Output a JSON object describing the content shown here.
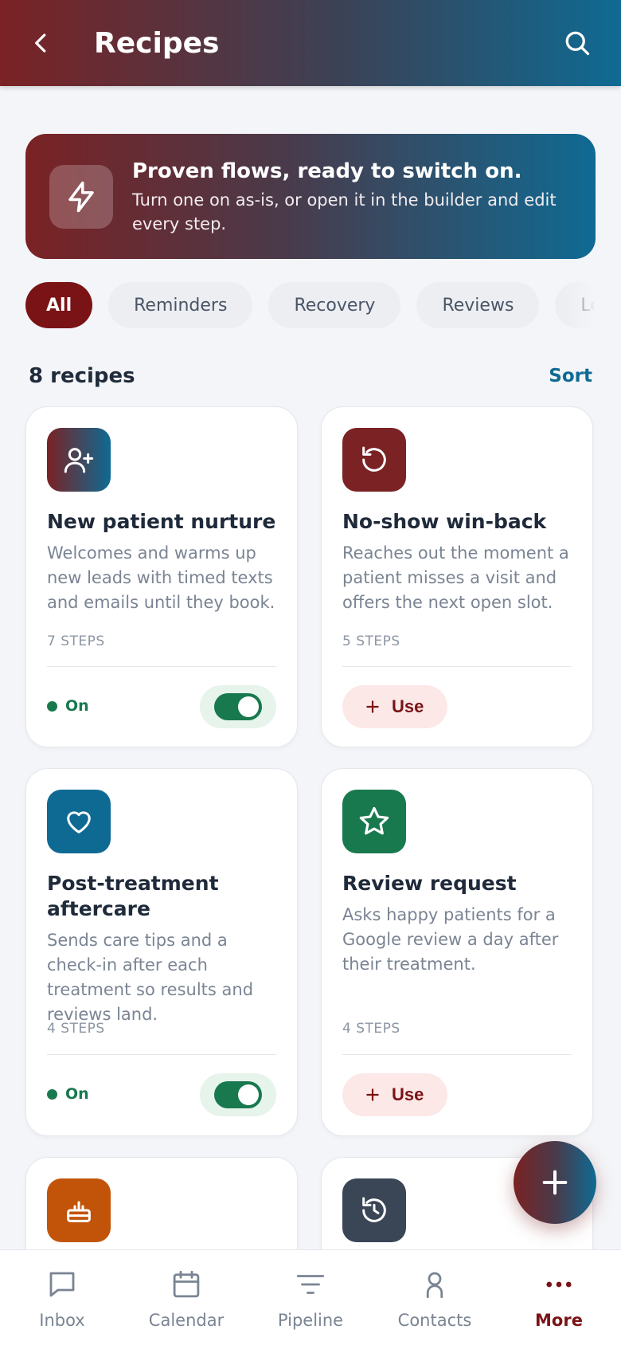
{
  "header": {
    "title": "Recipes",
    "back_icon": "chevron-left-icon",
    "search_icon": "search-icon"
  },
  "hero": {
    "icon": "bolt-icon",
    "heading": "Proven flows, ready to switch on.",
    "body": "Turn one on as-is, or open it in the builder and edit every step."
  },
  "filters": [
    {
      "label": "All",
      "active": true
    },
    {
      "label": "Reminders",
      "active": false
    },
    {
      "label": "Recovery",
      "active": false
    },
    {
      "label": "Reviews",
      "active": false
    },
    {
      "label": "Lead f",
      "active": false
    }
  ],
  "list": {
    "count_label": "8 recipes",
    "sort_label": "Sort"
  },
  "recipes": [
    {
      "name": "New patient nurture",
      "description": "Welcomes and warms up new leads with timed texts and emails until they book.",
      "steps": "7 STEPS",
      "state": "on",
      "status_label": "On",
      "icon": "user-plus-icon",
      "icon_color": "gradient"
    },
    {
      "name": "No-show win-back",
      "description": "Reaches out the moment a patient misses a visit and offers the next open slot.",
      "steps": "5 STEPS",
      "state": "off",
      "use_label": "Use",
      "icon": "rotate-ccw-icon",
      "icon_color": "#7a2224"
    },
    {
      "name": "Post-treatment aftercare",
      "description": "Sends care tips and a check-in after each treatment so results and reviews land.",
      "steps": "4 STEPS",
      "state": "on",
      "status_label": "On",
      "icon": "heart-icon",
      "icon_color": "#0f6a93"
    },
    {
      "name": "Review request",
      "description": "Asks happy patients for a Google review a day after their treatment.",
      "steps": "4 STEPS",
      "state": "off",
      "use_label": "Use",
      "icon": "star-icon",
      "icon_color": "#18794e"
    },
    {
      "name": "",
      "description": "",
      "steps": "",
      "state": "",
      "icon": "cake-icon",
      "icon_color": "#c2540a"
    },
    {
      "name": "",
      "description": "",
      "steps": "",
      "state": "",
      "icon": "history-icon",
      "icon_color": "#3a4656"
    }
  ],
  "fab": {
    "icon": "plus-icon"
  },
  "bottom_nav": [
    {
      "label": "Inbox",
      "icon": "message-icon",
      "active": false
    },
    {
      "label": "Calendar",
      "icon": "calendar-icon",
      "active": false
    },
    {
      "label": "Pipeline",
      "icon": "filter-icon",
      "active": false
    },
    {
      "label": "Contacts",
      "icon": "person-icon",
      "active": false
    },
    {
      "label": "More",
      "icon": "more-dots-icon",
      "active": true
    }
  ],
  "colors": {
    "brand_red": "#7a1316",
    "brand_blue": "#0f6a93",
    "success_green": "#18794e",
    "muted_text": "#7a8493"
  }
}
